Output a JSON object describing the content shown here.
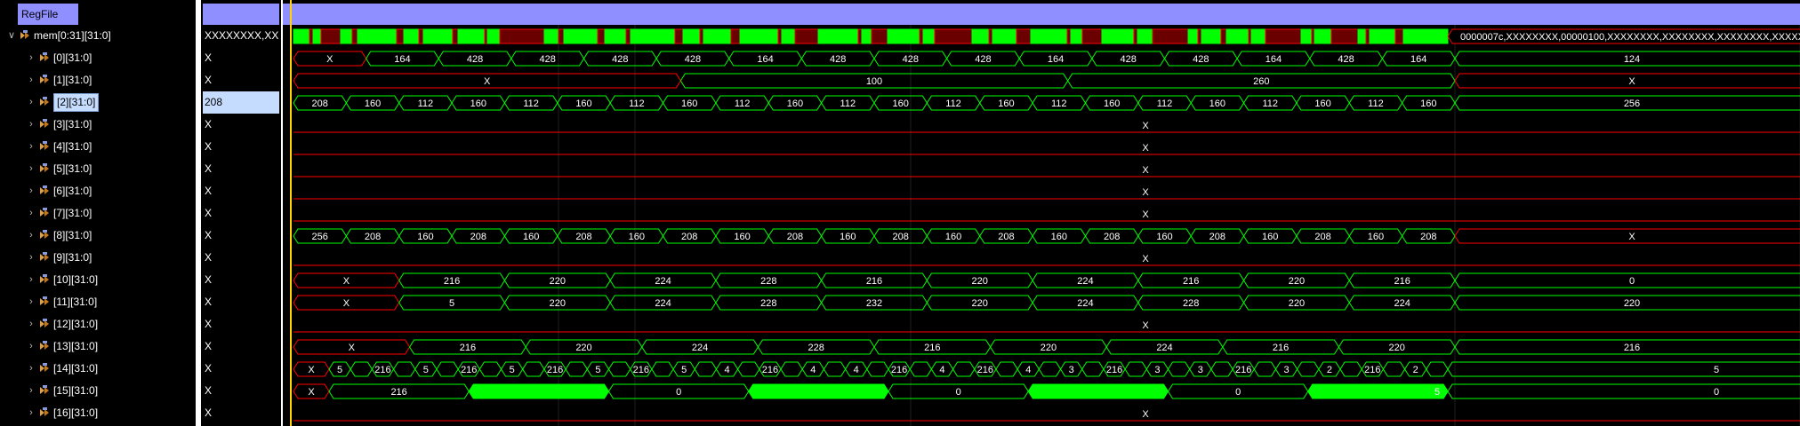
{
  "group": {
    "label": "RegFile"
  },
  "colors": {
    "bus": "#00ff00",
    "undefined": "#ff0000",
    "header": "#8f8fff",
    "cursor": "#ffd400",
    "selected_bg": "#c6dcff"
  },
  "rows": [
    {
      "name": "mem[0:31][31:0]",
      "value": "XXXXXXXX,XX",
      "chevron": "v",
      "icon": "bus-icon",
      "selected": false
    },
    {
      "name": "[0][31:0]",
      "value": "X",
      "chevron": ">",
      "icon": "bus-icon",
      "selected": false
    },
    {
      "name": "[1][31:0]",
      "value": "X",
      "chevron": ">",
      "icon": "bus-icon",
      "selected": false
    },
    {
      "name": "[2][31:0]",
      "value": "208",
      "chevron": ">",
      "icon": "bus-icon",
      "selected": true
    },
    {
      "name": "[3][31:0]",
      "value": "X",
      "chevron": ">",
      "icon": "bus-icon",
      "selected": false
    },
    {
      "name": "[4][31:0]",
      "value": "X",
      "chevron": ">",
      "icon": "bus-icon",
      "selected": false
    },
    {
      "name": "[5][31:0]",
      "value": "X",
      "chevron": ">",
      "icon": "bus-icon",
      "selected": false
    },
    {
      "name": "[6][31:0]",
      "value": "X",
      "chevron": ">",
      "icon": "bus-icon",
      "selected": false
    },
    {
      "name": "[7][31:0]",
      "value": "X",
      "chevron": ">",
      "icon": "bus-icon",
      "selected": false
    },
    {
      "name": "[8][31:0]",
      "value": "X",
      "chevron": ">",
      "icon": "bus-icon",
      "selected": false
    },
    {
      "name": "[9][31:0]",
      "value": "X",
      "chevron": ">",
      "icon": "bus-icon",
      "selected": false
    },
    {
      "name": "[10][31:0]",
      "value": "X",
      "chevron": ">",
      "icon": "bus-icon",
      "selected": false
    },
    {
      "name": "[11][31:0]",
      "value": "X",
      "chevron": ">",
      "icon": "bus-icon",
      "selected": false
    },
    {
      "name": "[12][31:0]",
      "value": "X",
      "chevron": ">",
      "icon": "bus-icon",
      "selected": false
    },
    {
      "name": "[13][31:0]",
      "value": "X",
      "chevron": ">",
      "icon": "bus-icon",
      "selected": false
    },
    {
      "name": "[14][31:0]",
      "value": "X",
      "chevron": ">",
      "icon": "bus-icon",
      "selected": false
    },
    {
      "name": "[15][31:0]",
      "value": "X",
      "chevron": ">",
      "icon": "bus-icon",
      "selected": false
    },
    {
      "name": "[16][31:0]",
      "value": "X",
      "chevron": ">",
      "icon": "bus-icon",
      "selected": false
    }
  ],
  "waves": [
    {
      "kind": "dense",
      "tail_label": "0000007c,XXXXXXXX,00000100,XXXXXXXX,XXXXXXXX,XXXXXXXX,XXXXXXXX,X"
    },
    {
      "kind": "segments",
      "segs": [
        [
          "X",
          "x"
        ],
        [
          "164",
          "v"
        ],
        [
          "428",
          "v"
        ],
        [
          "428",
          "v"
        ],
        [
          "428",
          "v"
        ],
        [
          "428",
          "v"
        ],
        [
          "164",
          "v"
        ],
        [
          "428",
          "v"
        ],
        [
          "428",
          "v"
        ],
        [
          "428",
          "v"
        ],
        [
          "164",
          "v"
        ],
        [
          "428",
          "v"
        ],
        [
          "428",
          "v"
        ],
        [
          "164",
          "v"
        ],
        [
          "428",
          "v"
        ],
        [
          "164",
          "v"
        ],
        [
          "124",
          "v"
        ]
      ]
    },
    {
      "kind": "segments",
      "segs": [
        [
          "X",
          "x"
        ],
        [
          "100",
          "v"
        ],
        [
          "260",
          "v"
        ],
        [
          "X",
          "x"
        ]
      ]
    },
    {
      "kind": "segments",
      "segs": [
        [
          "208",
          "v"
        ],
        [
          "160",
          "v"
        ],
        [
          "112",
          "v"
        ],
        [
          "160",
          "v"
        ],
        [
          "112",
          "v"
        ],
        [
          "160",
          "v"
        ],
        [
          "112",
          "v"
        ],
        [
          "160",
          "v"
        ],
        [
          "112",
          "v"
        ],
        [
          "160",
          "v"
        ],
        [
          "112",
          "v"
        ],
        [
          "160",
          "v"
        ],
        [
          "112",
          "v"
        ],
        [
          "160",
          "v"
        ],
        [
          "112",
          "v"
        ],
        [
          "160",
          "v"
        ],
        [
          "112",
          "v"
        ],
        [
          "160",
          "v"
        ],
        [
          "112",
          "v"
        ],
        [
          "160",
          "v"
        ],
        [
          "112",
          "v"
        ],
        [
          "160",
          "v"
        ],
        [
          "256",
          "v"
        ]
      ]
    },
    {
      "kind": "x",
      "label": "X"
    },
    {
      "kind": "x",
      "label": "X"
    },
    {
      "kind": "x",
      "label": "X"
    },
    {
      "kind": "x",
      "label": "X"
    },
    {
      "kind": "x",
      "label": "X"
    },
    {
      "kind": "segments",
      "segs": [
        [
          "256",
          "v"
        ],
        [
          "208",
          "v"
        ],
        [
          "160",
          "v"
        ],
        [
          "208",
          "v"
        ],
        [
          "160",
          "v"
        ],
        [
          "208",
          "v"
        ],
        [
          "160",
          "v"
        ],
        [
          "208",
          "v"
        ],
        [
          "160",
          "v"
        ],
        [
          "208",
          "v"
        ],
        [
          "160",
          "v"
        ],
        [
          "208",
          "v"
        ],
        [
          "160",
          "v"
        ],
        [
          "208",
          "v"
        ],
        [
          "160",
          "v"
        ],
        [
          "208",
          "v"
        ],
        [
          "160",
          "v"
        ],
        [
          "208",
          "v"
        ],
        [
          "160",
          "v"
        ],
        [
          "208",
          "v"
        ],
        [
          "160",
          "v"
        ],
        [
          "208",
          "v"
        ],
        [
          "X",
          "x"
        ]
      ]
    },
    {
      "kind": "x",
      "label": "X"
    },
    {
      "kind": "segments",
      "segs": [
        [
          "X",
          "x"
        ],
        [
          "216",
          "v"
        ],
        [
          "220",
          "v"
        ],
        [
          "224",
          "v"
        ],
        [
          "228",
          "v"
        ],
        [
          "216",
          "v"
        ],
        [
          "220",
          "v"
        ],
        [
          "224",
          "v"
        ],
        [
          "216",
          "v"
        ],
        [
          "220",
          "v"
        ],
        [
          "216",
          "v"
        ],
        [
          "0",
          "v"
        ]
      ]
    },
    {
      "kind": "segments",
      "segs": [
        [
          "X",
          "x"
        ],
        [
          "5",
          "v"
        ],
        [
          "220",
          "v"
        ],
        [
          "224",
          "v"
        ],
        [
          "228",
          "v"
        ],
        [
          "232",
          "v"
        ],
        [
          "220",
          "v"
        ],
        [
          "224",
          "v"
        ],
        [
          "228",
          "v"
        ],
        [
          "220",
          "v"
        ],
        [
          "224",
          "v"
        ],
        [
          "220",
          "v"
        ]
      ]
    },
    {
      "kind": "x",
      "label": "X"
    },
    {
      "kind": "segments",
      "segs": [
        [
          "X",
          "x"
        ],
        [
          "216",
          "v"
        ],
        [
          "220",
          "v"
        ],
        [
          "224",
          "v"
        ],
        [
          "228",
          "v"
        ],
        [
          "216",
          "v"
        ],
        [
          "220",
          "v"
        ],
        [
          "224",
          "v"
        ],
        [
          "216",
          "v"
        ],
        [
          "220",
          "v"
        ],
        [
          "216",
          "v"
        ]
      ]
    },
    {
      "kind": "busy",
      "head": "X",
      "labels": [
        "5",
        "216",
        "5",
        "216",
        "5",
        "216",
        "5",
        "216",
        "5",
        "4",
        "216",
        "4",
        "4",
        "216",
        "4",
        "216",
        "4",
        "3",
        "216",
        "3",
        "3",
        "216",
        "3",
        "2",
        "216",
        "2"
      ],
      "tail": "5"
    },
    {
      "kind": "busy2",
      "head": "X",
      "labels": [
        "216",
        "0",
        "0",
        "0"
      ],
      "tail": "0",
      "tail_pre": "5"
    },
    {
      "kind": "x",
      "label": "X"
    }
  ]
}
